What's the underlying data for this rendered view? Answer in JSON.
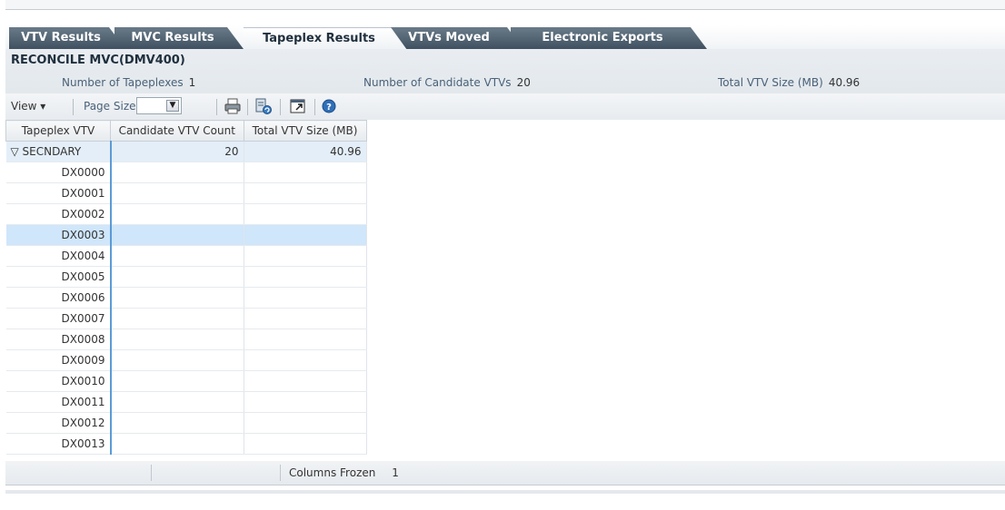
{
  "tabs": [
    {
      "label": "VTV Results",
      "active": false
    },
    {
      "label": "MVC Results",
      "active": false
    },
    {
      "label": "Tapeplex Results",
      "active": true
    },
    {
      "label": "VTVs Moved",
      "active": false
    },
    {
      "label": "Electronic Exports",
      "active": false
    }
  ],
  "panel": {
    "title": "RECONCILE MVC(DMV400)",
    "num_tapeplexes_label": "Number of Tapeplexes",
    "num_tapeplexes_value": "1",
    "num_candidates_label": "Number of Candidate VTVs",
    "num_candidates_value": "20",
    "total_size_label": "Total VTV Size (MB)",
    "total_size_value": "40.96"
  },
  "toolbar": {
    "view_label": "View ▾",
    "page_size_label": "Page Size",
    "icons": [
      "print-icon",
      "refresh-icon",
      "detach-icon",
      "help-icon"
    ]
  },
  "table": {
    "headers": [
      "Tapeplex VTV",
      "Candidate VTV Count",
      "Total VTV Size (MB)"
    ],
    "group": {
      "label": "▽ SECNDARY",
      "count": "20",
      "size": "40.96"
    },
    "rows": [
      "DX0000",
      "DX0001",
      "DX0002",
      "DX0003",
      "DX0004",
      "DX0005",
      "DX0006",
      "DX0007",
      "DX0008",
      "DX0009",
      "DX0010",
      "DX0011",
      "DX0012",
      "DX0013"
    ],
    "selected_row": "DX0003"
  },
  "status": {
    "columns_frozen_label": "Columns Frozen",
    "columns_frozen_value": "1"
  },
  "colors": {
    "tab_dark": "#3f5060",
    "selected_row": "#cfe6fb",
    "group_row": "#e4eef8",
    "frozen_divider": "#5b9bd5"
  }
}
